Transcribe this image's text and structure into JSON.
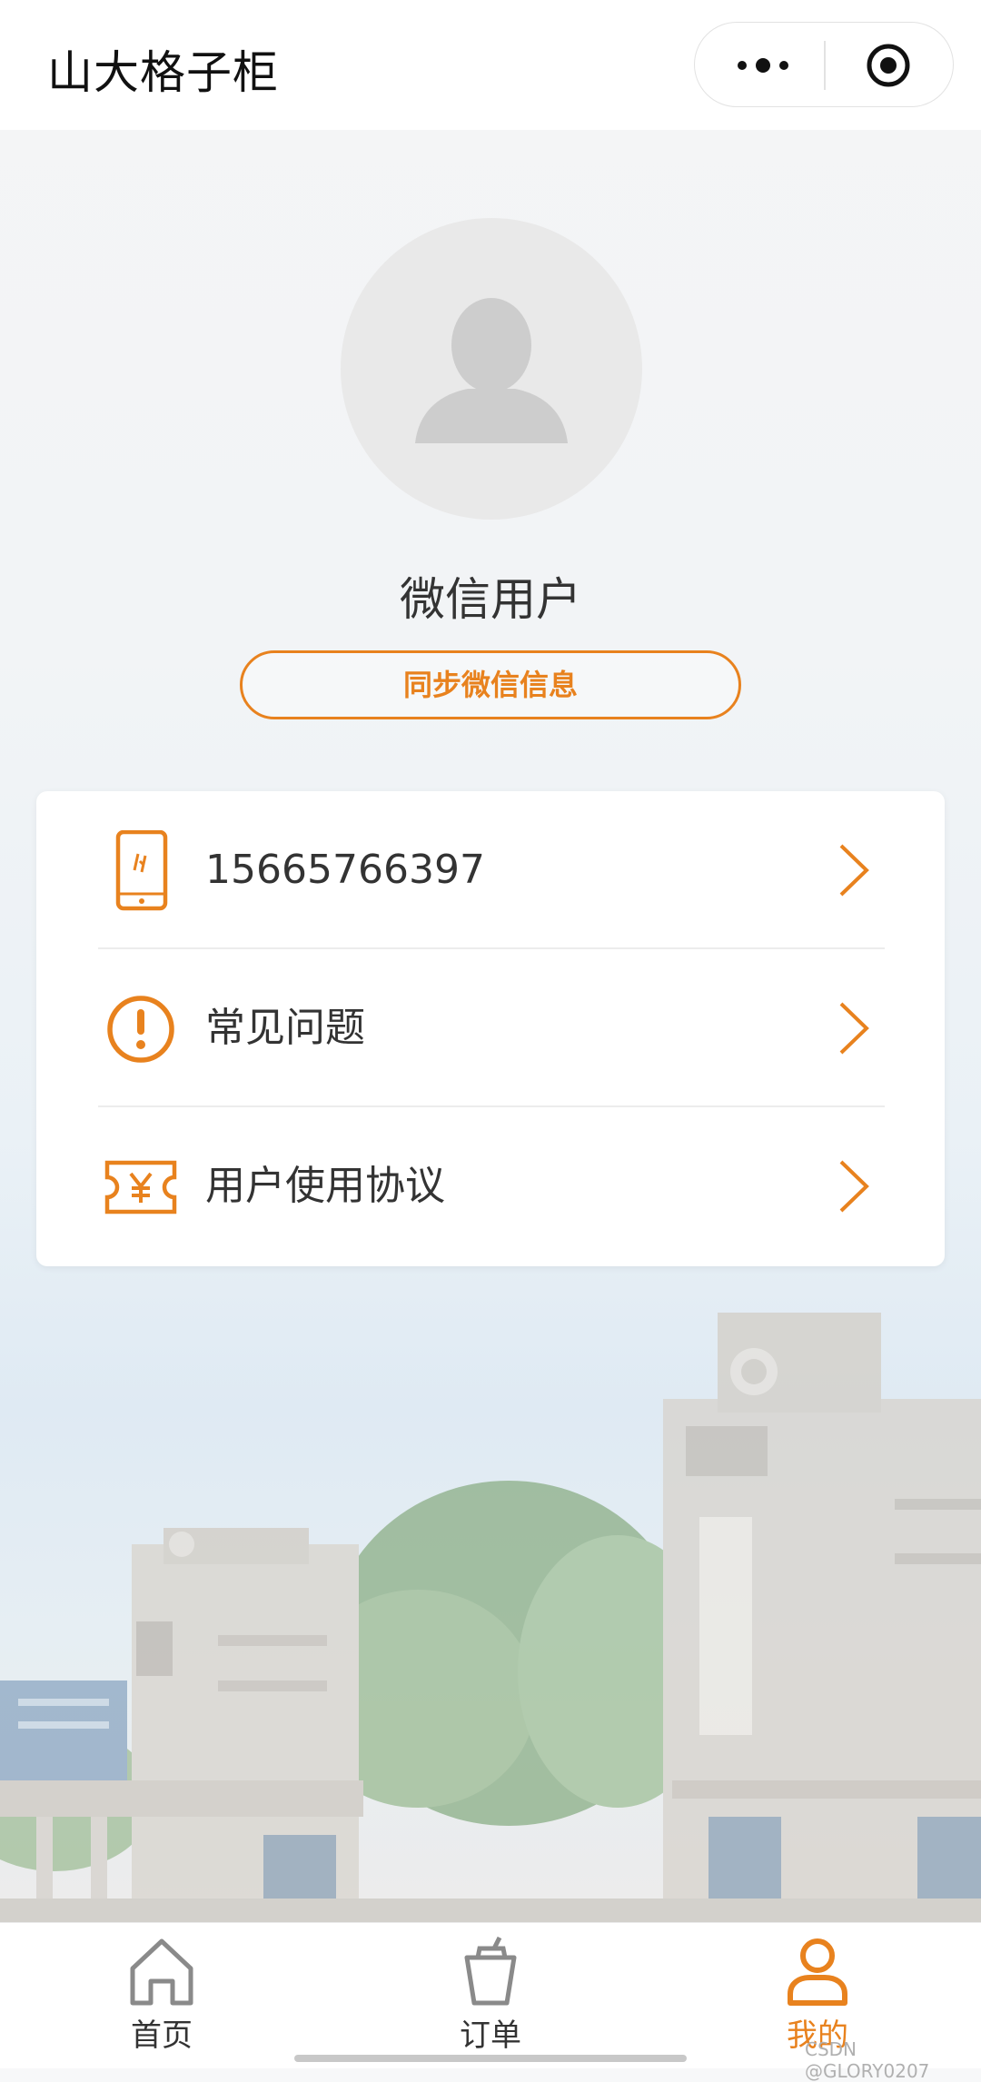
{
  "header": {
    "title": "山大格子柜"
  },
  "profile": {
    "nickname": "微信用户",
    "sync_button": "同步微信信息"
  },
  "menu": [
    {
      "label": "15665766397",
      "icon": "phone-icon"
    },
    {
      "label": "常见问题",
      "icon": "exclamation-circle-icon"
    },
    {
      "label": "用户使用协议",
      "icon": "ticket-yuan-icon"
    }
  ],
  "tabs": [
    {
      "label": "首页",
      "icon": "home-icon",
      "active": false
    },
    {
      "label": "订单",
      "icon": "cup-icon",
      "active": false
    },
    {
      "label": "我的",
      "icon": "user-icon",
      "active": true
    }
  ],
  "watermark": "CSDN @GLORY0207",
  "colors": {
    "accent": "#e8821e",
    "text": "#333333"
  }
}
